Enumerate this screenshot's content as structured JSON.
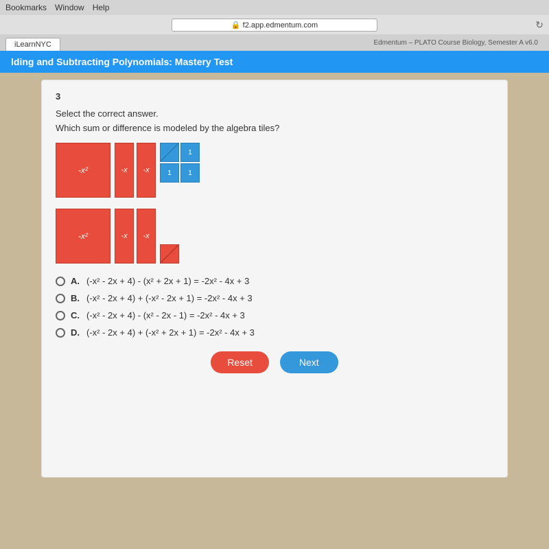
{
  "browser": {
    "menu_items": [
      "Bookmarks",
      "Window",
      "Help"
    ],
    "address": "f2.app.edmentum.com",
    "lock_icon": "🔒",
    "tab1": "iLearnNYC",
    "tab2": "Edmentum – PLATO Course Biology, Semester A v6.0",
    "refresh_icon": "↻"
  },
  "page_title": "lding and Subtracting Polynomials: Mastery Test",
  "question": {
    "number": "3",
    "instruction": "Select the correct answer.",
    "text": "Which sum or difference is modeled by the algebra tiles?",
    "options": [
      {
        "label": "A.",
        "text": "(-x² - 2x + 4) - (x² + 2x + 1) = -2x² - 4x + 3"
      },
      {
        "label": "B.",
        "text": "(-x² - 2x + 4) + (-x² - 2x + 1) = -2x² - 4x + 3"
      },
      {
        "label": "C.",
        "text": "(-x² - 2x + 4) - (x² - 2x - 1) = -2x² - 4x + 3"
      },
      {
        "label": "D.",
        "text": "(-x² - 2x + 4) + (-x² + 2x + 1) = -2x² - 4x + 3"
      }
    ]
  },
  "buttons": {
    "reset": "Reset",
    "next": "Next"
  }
}
